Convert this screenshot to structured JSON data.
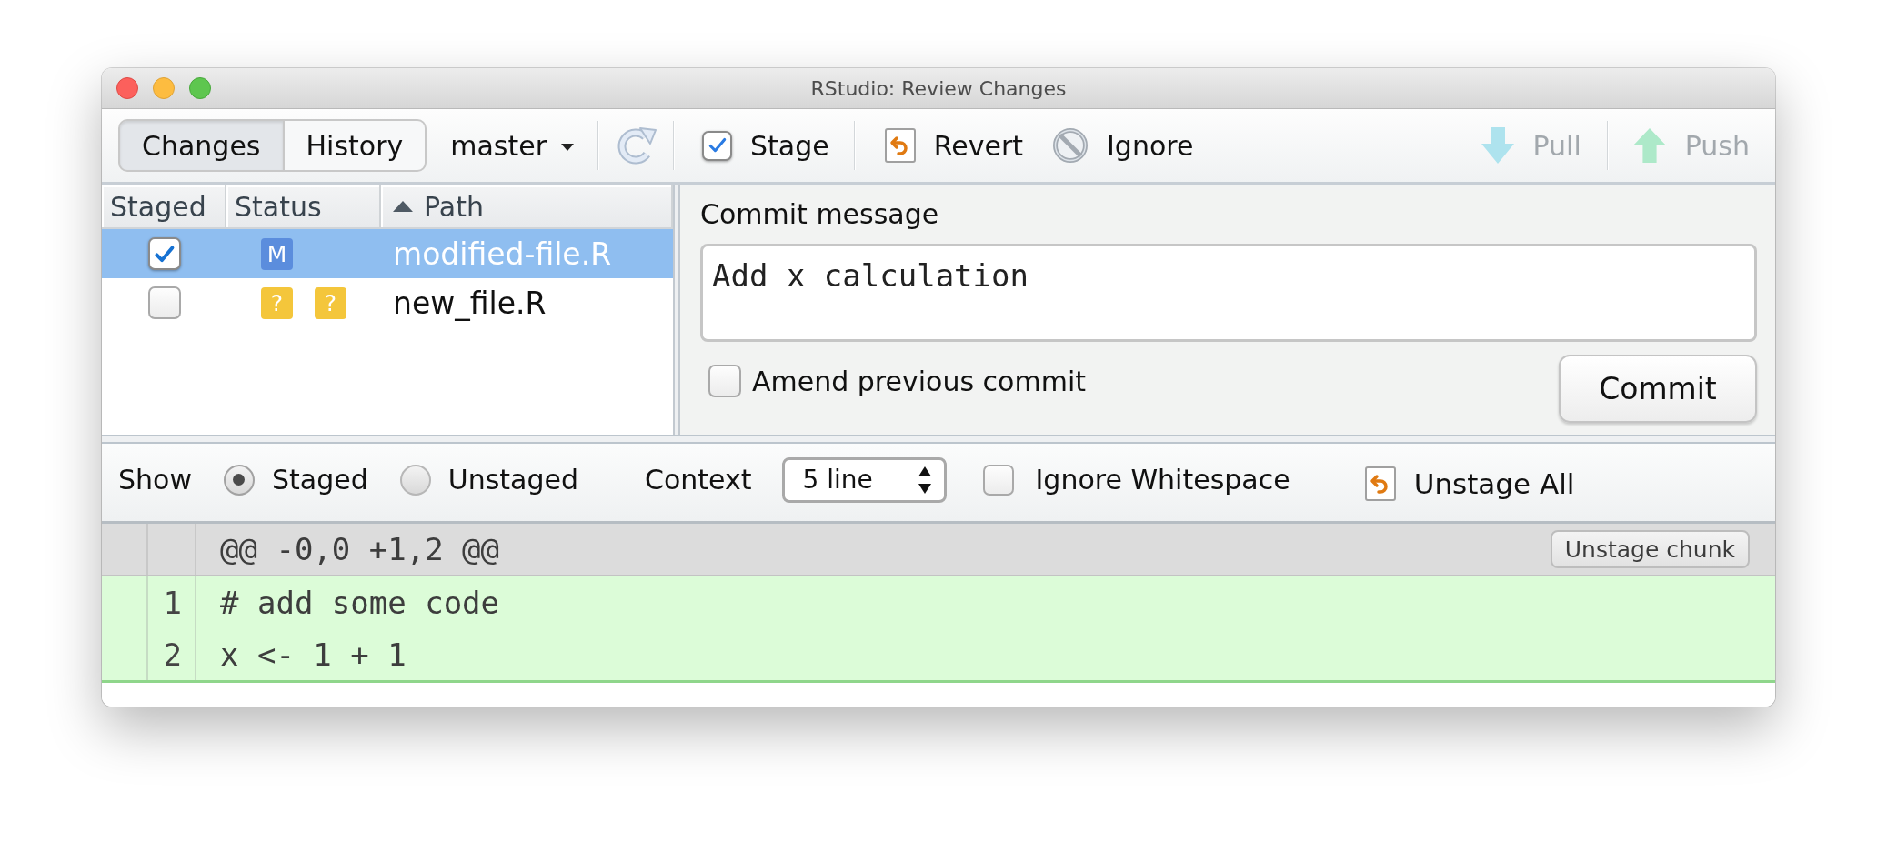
{
  "window": {
    "title": "RStudio: Review Changes"
  },
  "toolbar": {
    "view_tabs": [
      {
        "label": "Changes",
        "selected": true
      },
      {
        "label": "History",
        "selected": false
      }
    ],
    "branch": "master",
    "stage": {
      "label": "Stage",
      "checked": true
    },
    "actions": [
      {
        "kind": "revert",
        "label": "Revert",
        "disabled": false
      },
      {
        "kind": "ignore",
        "label": "Ignore",
        "disabled": false
      }
    ],
    "remote_actions": [
      {
        "kind": "pull",
        "label": "Pull",
        "disabled": true
      },
      {
        "kind": "push",
        "label": "Push",
        "disabled": true
      }
    ]
  },
  "files": {
    "columns": [
      {
        "label": "Staged",
        "sorted": false
      },
      {
        "label": "Status",
        "sorted": false
      },
      {
        "label": "Path",
        "sorted": true
      }
    ],
    "rows": [
      {
        "selected": true,
        "staged": true,
        "status": [
          {
            "text": "M",
            "color": "#5b8ddd"
          }
        ],
        "path": "modified-file.R"
      },
      {
        "selected": false,
        "staged": false,
        "status": [
          {
            "text": "?",
            "color": "#f4c63b"
          },
          {
            "text": "?",
            "color": "#f4c63b"
          }
        ],
        "path": "new_file.R"
      }
    ]
  },
  "commit": {
    "label": "Commit message",
    "message": "Add x calculation",
    "amend": {
      "label": "Amend previous commit",
      "checked": false
    },
    "button": "Commit"
  },
  "diff_options": {
    "show_label": "Show",
    "views": [
      {
        "label": "Staged",
        "selected": true
      },
      {
        "label": "Unstaged",
        "selected": false
      }
    ],
    "context_label": "Context",
    "context_value": "5 line",
    "ignore_whitespace": {
      "label": "Ignore Whitespace",
      "checked": false
    },
    "unstage_all": "Unstage All"
  },
  "diff": {
    "hunk_header": "@@ -0,0 +1,2 @@",
    "hunk_button": "Unstage chunk",
    "lines": [
      {
        "kind": "added",
        "new_number": "1",
        "text": "# add some code"
      },
      {
        "kind": "added",
        "new_number": "2",
        "text": "x <- 1 + 1"
      }
    ]
  }
}
